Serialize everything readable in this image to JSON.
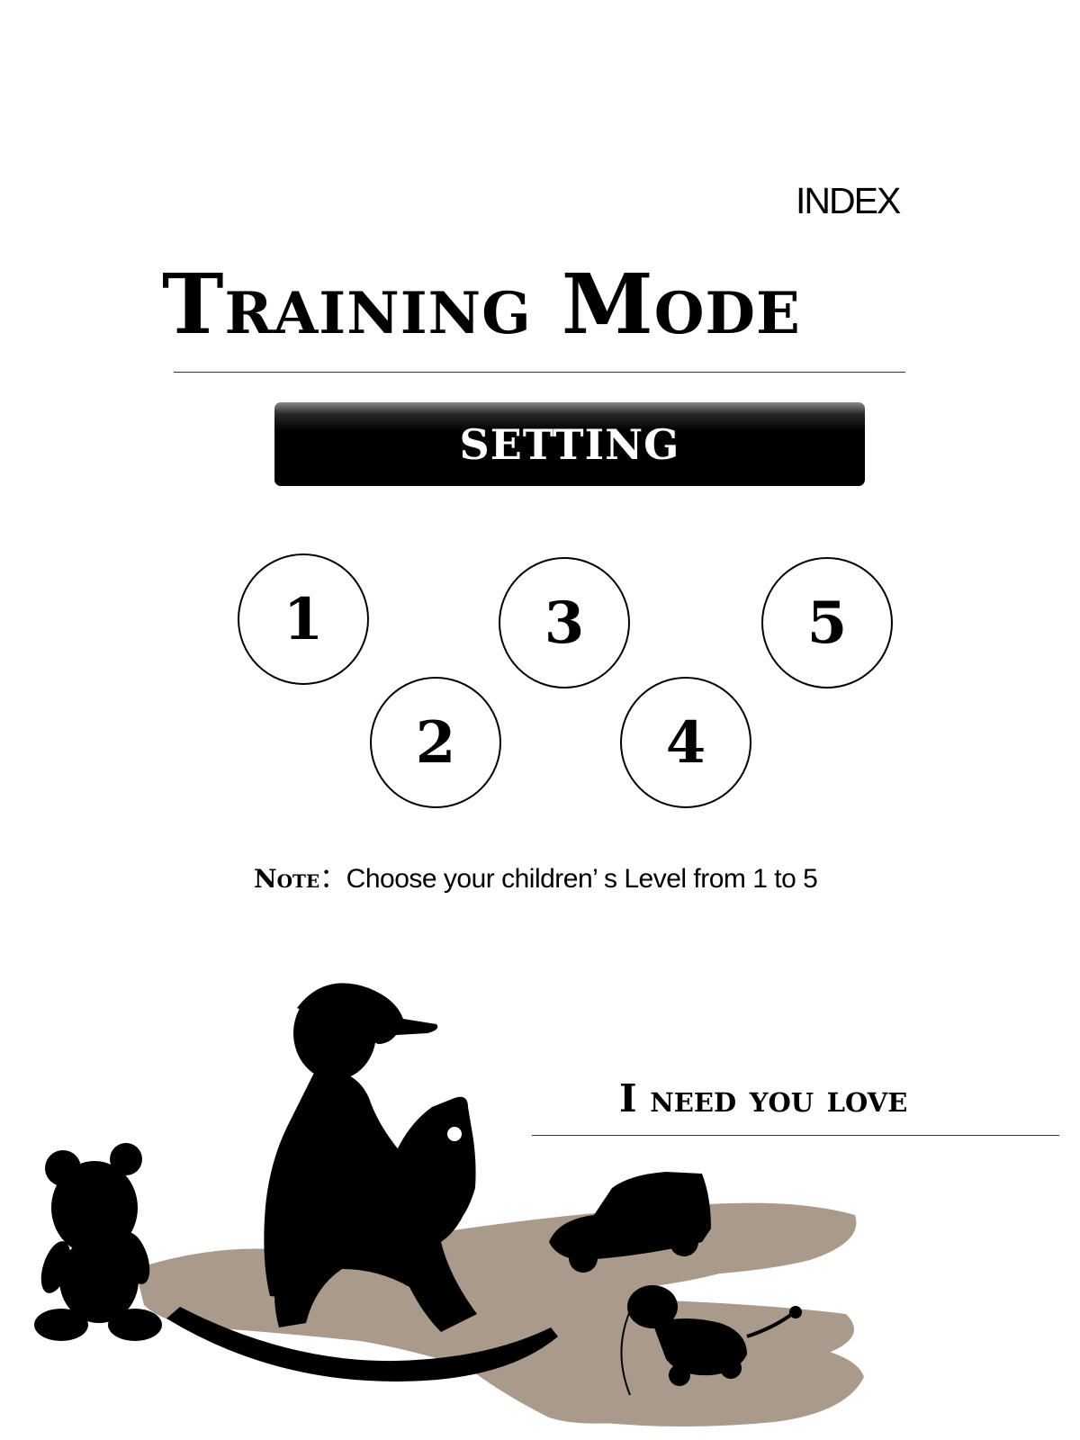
{
  "header": {
    "index_label": "INDEX",
    "title": "Training Mode"
  },
  "setting_button": {
    "label": "SETTING"
  },
  "levels": {
    "l1": "1",
    "l2": "2",
    "l3": "3",
    "l4": "4",
    "l5": "5"
  },
  "note": {
    "label": "Note",
    "separator": "：",
    "text": "Choose your children’ s Level from 1 to 5"
  },
  "tagline": "I need you love",
  "illustration": {
    "icon": "child-on-rocking-horse-silhouette",
    "colors": {
      "silhouette": "#000000",
      "shadow": "#a99a8c"
    }
  }
}
